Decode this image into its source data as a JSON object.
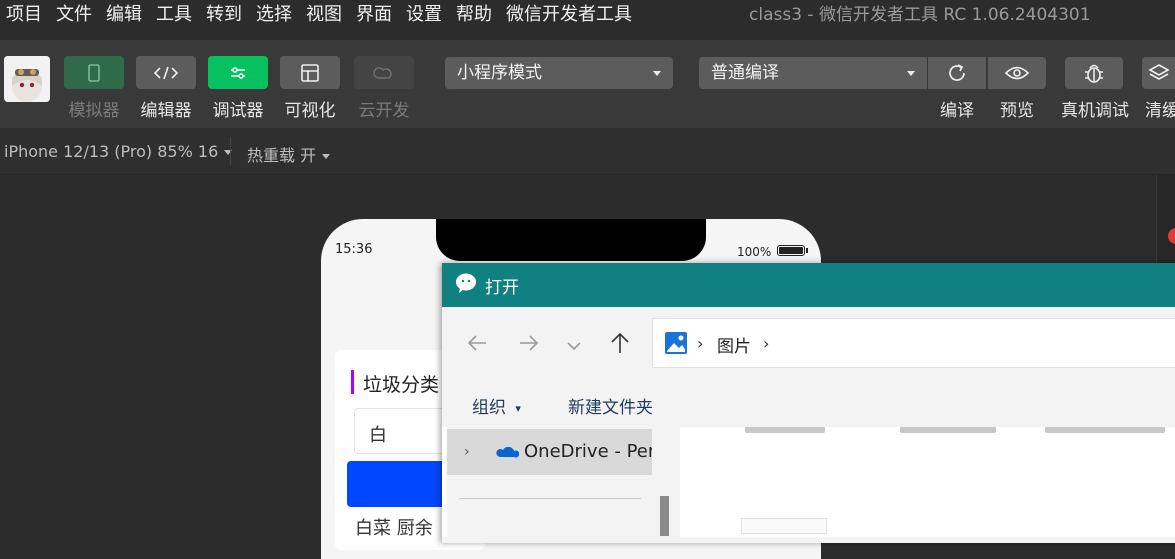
{
  "menubar": {
    "items": [
      "项目",
      "文件",
      "编辑",
      "工具",
      "转到",
      "选择",
      "视图",
      "界面",
      "设置",
      "帮助",
      "微信开发者工具"
    ],
    "window_title": "class3 - 微信开发者工具 RC 1.06.2404301"
  },
  "toolbar": {
    "simulator_label": "模拟器",
    "editor_label": "编辑器",
    "debugger_label": "调试器",
    "visual_label": "可视化",
    "cloud_label": "云开发",
    "mode_select": "小程序模式",
    "compile_select": "普通编译",
    "compile_label": "编译",
    "preview_label": "预览",
    "device_debug_label": "真机调试",
    "clear_cache_label": "清缓",
    "accent_green": "#07c160"
  },
  "subbar": {
    "device": "iPhone 12/13 (Pro) 85% 16",
    "hot_reload": "热重载 开"
  },
  "phone": {
    "time": "15:36",
    "battery": "100%",
    "card_title": "垃圾分类",
    "input_value": "白",
    "result_text": "白菜 厨余"
  },
  "dialog": {
    "title": "打开",
    "breadcrumb": "图片",
    "organize_label": "组织",
    "new_folder_label": "新建文件夹",
    "onedrive_label": "OneDrive - Per",
    "header_color": "#108080"
  }
}
